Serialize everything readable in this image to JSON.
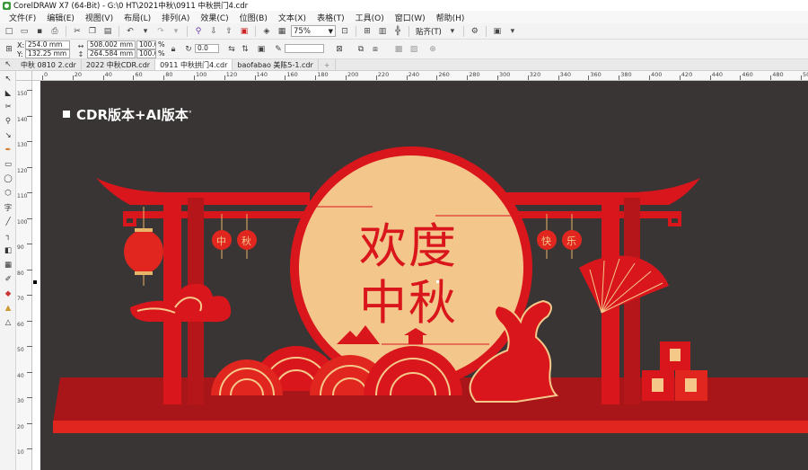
{
  "window": {
    "title": "CorelDRAW X7 (64-Bit) - G:\\0 HT\\2021中秋\\0911 中秋拱门4.cdr"
  },
  "menu": {
    "items": [
      "文件(F)",
      "编辑(E)",
      "视图(V)",
      "布局(L)",
      "排列(A)",
      "效果(C)",
      "位图(B)",
      "文本(X)",
      "表格(T)",
      "工具(O)",
      "窗口(W)",
      "帮助(H)"
    ]
  },
  "toolbar": {
    "zoom": "75%",
    "snap_label": "贴齐(T)"
  },
  "properties": {
    "x_label": "X:",
    "x_value": "254.0 mm",
    "y_label": "Y:",
    "y_value": "132.25 mm",
    "w_value": "508.002 mm",
    "h_value": "264.584 mm",
    "scale_x": "100.0",
    "scale_y": "100.0",
    "percent": "%",
    "rotation": "0.0"
  },
  "tabs": [
    "中秋 0810 2.cdr",
    "2022 中秋CDR.cdr",
    "0911 中秋拱门4.cdr",
    "baofabao 美陈5-1.cdr"
  ],
  "tab_add": "+",
  "ruler": {
    "ticks": [
      "0",
      "20",
      "40",
      "60",
      "80",
      "100",
      "120",
      "140",
      "160",
      "180",
      "200",
      "220",
      "240",
      "260",
      "280",
      "300",
      "320",
      "340",
      "360",
      "380",
      "400",
      "420",
      "440",
      "460",
      "480",
      "500"
    ],
    "vticks": [
      "150",
      "140",
      "130",
      "120",
      "110",
      "100",
      "90",
      "80",
      "70",
      "60",
      "50",
      "40",
      "30",
      "20",
      "10"
    ]
  },
  "artwork": {
    "heading": "CDR版本+AI版本",
    "heading_suffix": "°",
    "title_line1": "欢度",
    "title_line2": "中秋",
    "lantern_left": [
      "中",
      "秋"
    ],
    "lantern_right": [
      "快",
      "乐"
    ],
    "colors": {
      "background": "#3a3535",
      "red": "#d9161c",
      "dark_red": "#a8161a",
      "moon": "#f3c78b",
      "gold": "#f5c88a"
    }
  }
}
